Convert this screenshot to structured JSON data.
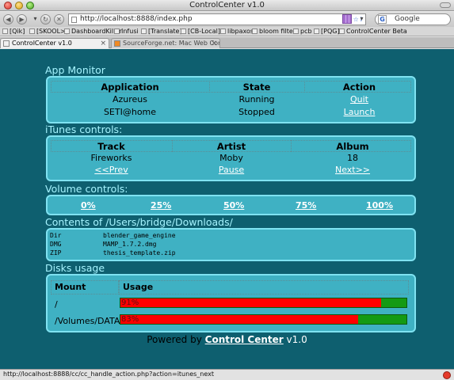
{
  "window": {
    "title": "ControlCenter v1.0"
  },
  "toolbar": {
    "url": "http://localhost:8888/index.php",
    "search_placeholder": "Google",
    "back_icon": "back-arrow-icon",
    "forward_icon": "forward-arrow-icon",
    "reload_icon": "reload-icon",
    "stop_icon": "stop-icon",
    "home_icon": "home-icon"
  },
  "bookmarks": [
    "[Qik]",
    "[SKOOL>]",
    "DashboardKiller",
    "Infusi",
    "[Translate]",
    "[CB-Local]",
    "libpaxos",
    "bloom filter",
    "pcb",
    "[PQG]",
    "ControlCenter Beta"
  ],
  "tabs": [
    {
      "label": "ControlCenter v1.0",
      "active": true
    },
    {
      "label": "SourceForge.net: Mac Web Control Cen...",
      "active": false
    }
  ],
  "app_monitor": {
    "title": "App Monitor",
    "headers": [
      "Application",
      "State",
      "Action"
    ],
    "rows": [
      {
        "app": "Azureus",
        "state": "Running",
        "action": "Quit"
      },
      {
        "app": "SETI@home",
        "state": "Stopped",
        "action": "Launch"
      }
    ]
  },
  "itunes": {
    "title": "iTunes controls:",
    "headers": [
      "Track",
      "Artist",
      "Album"
    ],
    "now_playing": {
      "track": "Fireworks",
      "artist": "Moby",
      "album": "18"
    },
    "controls": {
      "prev": "<<Prev",
      "pause": "Pause",
      "next": "Next>>"
    }
  },
  "volume": {
    "title": "Volume controls:",
    "levels": [
      "0%",
      "25%",
      "50%",
      "75%",
      "100%"
    ]
  },
  "contents": {
    "title": "Contents of /Users/bridge/Downloads/",
    "items": [
      {
        "type": "Dir",
        "name": "blender_game_engine"
      },
      {
        "type": "DMG",
        "name": "MAMP_1.7.2.dmg"
      },
      {
        "type": "ZIP",
        "name": "thesis_template.zip"
      }
    ]
  },
  "disks": {
    "title": "Disks usage",
    "headers": [
      "Mount",
      "Usage"
    ],
    "rows": [
      {
        "mount": "/",
        "usage_label": "91%",
        "usage": 0.91
      },
      {
        "mount": "/Volumes/DATA",
        "usage_label": "83%",
        "usage": 0.83
      }
    ],
    "colors": {
      "used": "#ff0000",
      "free": "#149a14"
    }
  },
  "footer": {
    "prefix": "Powered by",
    "brand": "Control Center",
    "version": "v1.0"
  },
  "status_bar": {
    "text": "http://localhost:8888/cc/cc_handle_action.php?action=itunes_next"
  },
  "colors": {
    "page_bg": "#0e5f6f",
    "panel_bg": "#3fb1c3",
    "panel_border": "#7fe2f1",
    "section_title": "#a6f4ff"
  }
}
